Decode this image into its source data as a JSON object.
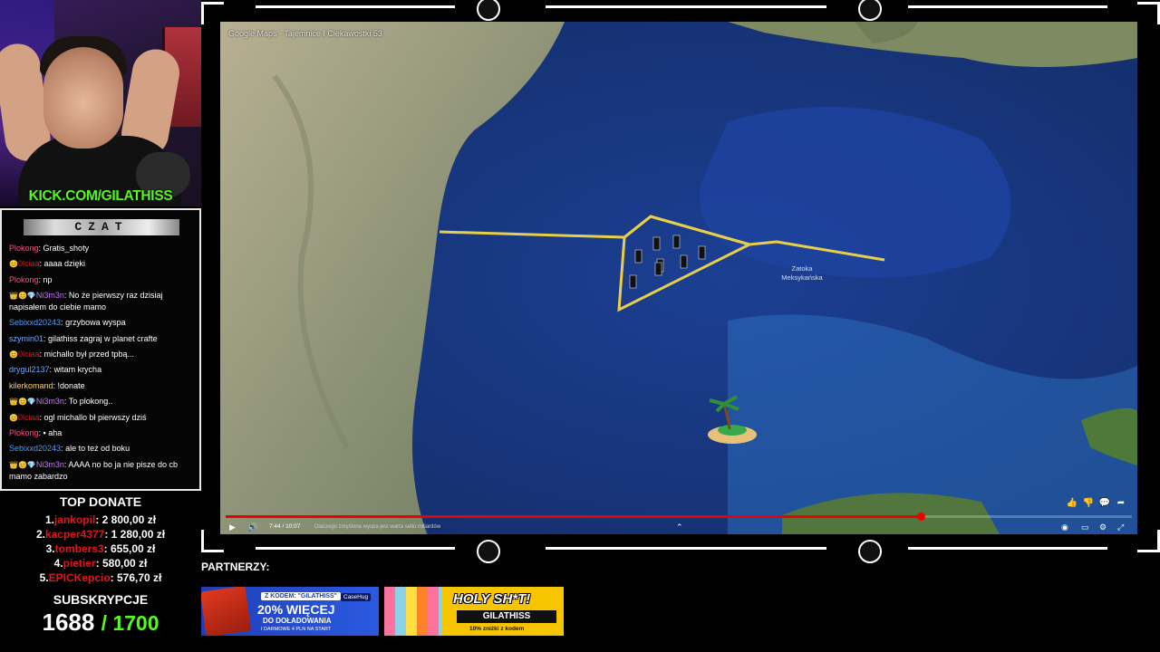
{
  "stream": {
    "kick_url": "KICK.COM/GILATHISS",
    "chat_title": "CZAT"
  },
  "chat": [
    {
      "badges": "",
      "user": "Plokong",
      "user_color": "#ff4d8a",
      "text": "Gratis_shoty"
    },
    {
      "badges": "😊",
      "user": "0lciaa",
      "user_color": "#e0161b",
      "text": "aaaa dzięki"
    },
    {
      "badges": "",
      "user": "Plokong",
      "user_color": "#ff4d8a",
      "text": "np"
    },
    {
      "badges": "👑😊💎",
      "user": "Ni3m3n",
      "user_color": "#c874ff",
      "text": "No że pierwszy raz dzisiaj napisałem do ciebie mamo",
      "wrap": true
    },
    {
      "badges": "",
      "user": "Sebixxd20243",
      "user_color": "#4c9bff",
      "text": "grzybowa wyspa"
    },
    {
      "badges": "",
      "user": "szymin01",
      "user_color": "#7aa7ff",
      "text": "gilathiss zagraj w planet crafte"
    },
    {
      "badges": "😊",
      "user": "0lciaa",
      "user_color": "#e0161b",
      "text": "michallo był przed tpbą..."
    },
    {
      "badges": "",
      "user": "drygul2137",
      "user_color": "#6fa9ff",
      "text": "witam krycha"
    },
    {
      "badges": "",
      "user": "kilerkomand",
      "user_color": "#f2d36b",
      "text": "!donate"
    },
    {
      "badges": "👑😊💎",
      "user": "Ni3m3n",
      "user_color": "#c874ff",
      "text": "To plokong.."
    },
    {
      "badges": "😊",
      "user": "0lciaa",
      "user_color": "#e0161b",
      "text": "ogl michallo bł pierwszy dziś"
    },
    {
      "badges": "",
      "user": "Plokong",
      "user_color": "#ff4d8a",
      "text": "▪ aha"
    },
    {
      "badges": "",
      "user": "Sebixxd20243",
      "user_color": "#4c9bff",
      "text": "ale to też od boku"
    },
    {
      "badges": "👑😊💎",
      "user": "Ni3m3n",
      "user_color": "#c874ff",
      "text": "AAAA no bo ja nie pisze do cb mamo zabardzo",
      "wrap": true
    }
  ],
  "top_donate": {
    "title": "TOP DONATE",
    "entries": [
      {
        "rank": "1.",
        "name": "jankopil",
        "amount": ": 2 800,00 zł"
      },
      {
        "rank": "2.",
        "name": "kacper4377",
        "amount": ": 1 280,00 zł"
      },
      {
        "rank": "3.",
        "name": "tombers3",
        "amount": ": 655,00 zł"
      },
      {
        "rank": "4.",
        "name": "pietier",
        "amount": ": 580,00 zł"
      },
      {
        "rank": "5.",
        "name": "EPICKepcio",
        "amount": ": 576,70 zł"
      }
    ]
  },
  "subs": {
    "title": "SUBSKRYPCJE",
    "current": "1688",
    "goal": "/ 1700"
  },
  "video": {
    "title": "Google Maps - Tajemnice I Ciekawostki 53",
    "map_label_line1": "Zatoka",
    "map_label_line2": "Meksykańska",
    "time": "7:44 / 10:07",
    "chapter": "Dlaczego zmyślona wyspa jest warta setki miliardów",
    "progress": 0.767
  },
  "partners": {
    "title": "PARTNERZY:",
    "banner1": {
      "code": "Z KODEM: \"GILATHISS\"",
      "bonus": "20% WIĘCEJ",
      "line2": "DO DOŁADOWANIA",
      "line3": "I DARMOWE 4 PLN NA START",
      "brand": "CaseHug"
    },
    "banner2": {
      "headline": "HOLY SH*T!",
      "code": "GILATHISS",
      "discount": "10% zniżki z kodem"
    }
  }
}
